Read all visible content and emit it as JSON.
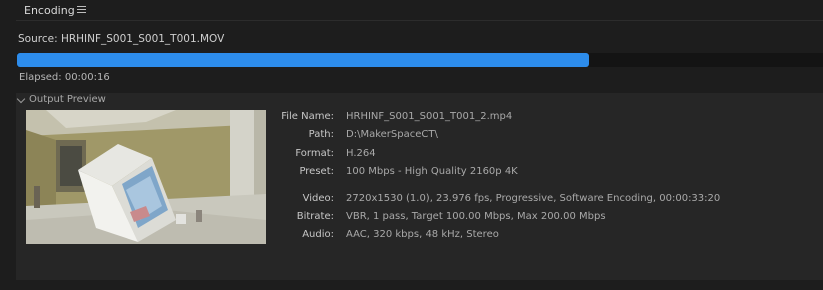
{
  "panel_tab": {
    "title": "Encoding",
    "menu_icon": "hamburger-menu-icon"
  },
  "source": {
    "text": "Source: HRHINF_S001_S001_T001.MOV"
  },
  "progress": {
    "fraction": 0.71,
    "color": "#2d8ceb"
  },
  "elapsed": {
    "text": "Elapsed: 00:00:16"
  },
  "output_preview": {
    "title": "Output Preview",
    "toggle_icon": "chevron-down-icon",
    "properties": [
      {
        "label": "File Name:",
        "value": "HRHINF_S001_S001_T001_2.mp4"
      },
      {
        "label": "Path:",
        "value": "D:\\MakerSpaceCT\\"
      },
      {
        "label": "Format:",
        "value": "H.264"
      },
      {
        "label": "Preset:",
        "value": "100 Mbps - High Quality 2160p 4K"
      },
      {
        "label": "Video:",
        "value": "2720x1530 (1.0), 23.976 fps, Progressive, Software Encoding, 00:00:33:20"
      },
      {
        "label": "Bitrate:",
        "value": "VBR, 1 pass, Target 100.00 Mbps, Max 200.00 Mbps"
      },
      {
        "label": "Audio:",
        "value": "AAC, 320 kbps, 48 kHz, Stereo"
      }
    ]
  },
  "colors": {
    "background": "#1d1d1d",
    "panel": "#262626",
    "accent": "#2d8ceb"
  }
}
